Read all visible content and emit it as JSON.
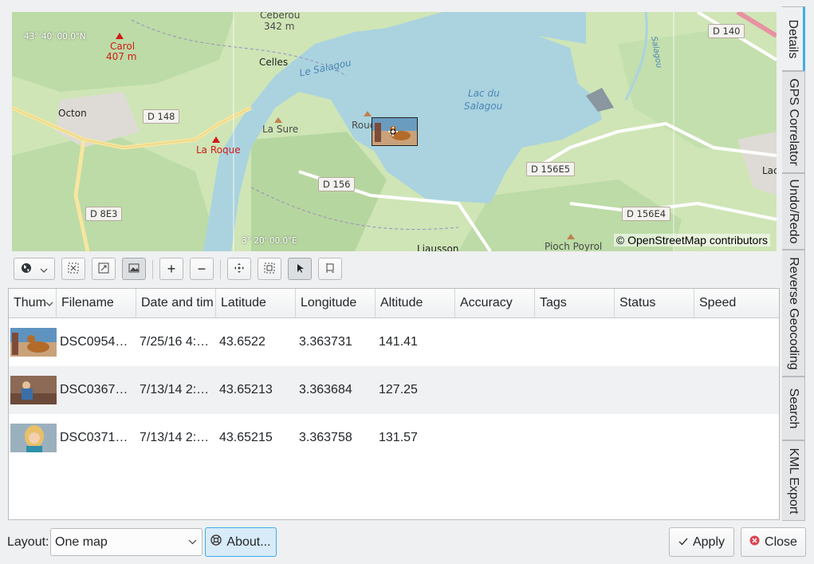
{
  "map": {
    "labels": {
      "cebérou": "Cébérou",
      "cebérou_alt": "342 m",
      "carol": "Carol",
      "carol_alt": "407 m",
      "celles": "Celles",
      "octon": "Octon",
      "la_sure": "La Sure",
      "la_roque": "La Roque",
      "roue": "Roue",
      "le_salagou": "Le Salagou",
      "lac_du": "Lac du",
      "salagou": "Salagou",
      "liausson": "Liausson",
      "pioch_poyrol": "Pioch Poyrol",
      "lac": "Lac",
      "salagou_river": "Salagou"
    },
    "roads": {
      "d148": "D 148",
      "d140": "D 140",
      "d156": "D 156",
      "d156e5": "D 156E5",
      "d156e4": "D 156E4",
      "d8e3": "D 8E3"
    },
    "coords": {
      "lat": "43° 40' 00.0\"N",
      "lon": "3° 20' 00.0\"E"
    },
    "attribution": "© OpenStreetMap contributors",
    "colors": {
      "land": "#cfe5b6",
      "water": "#aad3df",
      "forest": "#add19e",
      "urban": "#e0dfdf"
    }
  },
  "toolbar": {
    "icons": [
      "globe-icon",
      "zoom-fit-icon",
      "zoom-selection-icon",
      "show-thumbnails-icon",
      "zoom-in-icon",
      "zoom-out-icon",
      "pan-icon",
      "select-rectangle-icon",
      "pointer-icon",
      "flag-icon"
    ],
    "zoom_in": "+",
    "zoom_out": "−"
  },
  "table": {
    "columns": [
      "Thumbnail",
      "Filename",
      "Date and time",
      "Latitude",
      "Longitude",
      "Altitude",
      "Accuracy",
      "Tags",
      "Status",
      "Speed"
    ],
    "columns_visible": [
      "Thum",
      "Filename",
      "Date and tim",
      "Latitude",
      "Longitude",
      "Altitude",
      "Accuracy",
      "Tags",
      "Status",
      "Speed"
    ],
    "rows": [
      {
        "filename": "DSC0954…",
        "datetime": "7/25/16 4:…",
        "latitude": "43.6522",
        "longitude": "3.363731",
        "altitude": "141.41",
        "accuracy": "",
        "tags": "",
        "status": "",
        "speed": ""
      },
      {
        "filename": "DSC0367…",
        "datetime": "7/13/14 2:…",
        "latitude": "43.65213",
        "longitude": "3.363684",
        "altitude": "127.25",
        "accuracy": "",
        "tags": "",
        "status": "",
        "speed": ""
      },
      {
        "filename": "DSC0371…",
        "datetime": "7/13/14 2:…",
        "latitude": "43.65215",
        "longitude": "3.363758",
        "altitude": "131.57",
        "accuracy": "",
        "tags": "",
        "status": "",
        "speed": ""
      }
    ]
  },
  "side_tabs": [
    "Details",
    "GPS Correlator",
    "Undo/Redo",
    "Reverse Geocoding",
    "Search",
    "KML Export"
  ],
  "bottom": {
    "layout_label": "Layout:",
    "layout_value": "One map",
    "about_label": "About...",
    "apply_label": "Apply",
    "close_label": "Close"
  },
  "accent_color": "#3daee9"
}
